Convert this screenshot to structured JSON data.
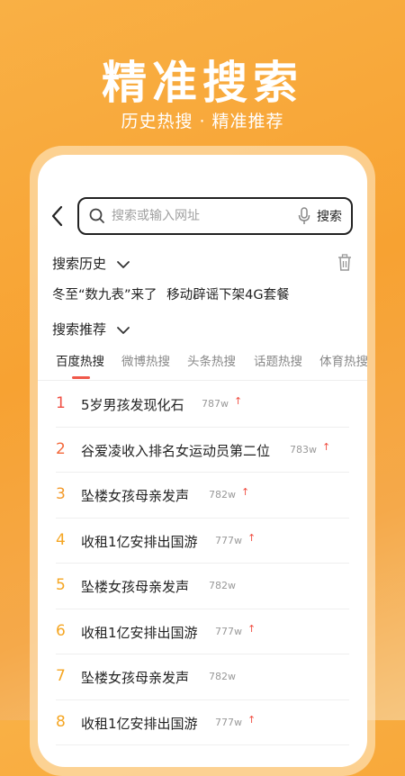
{
  "hero": {
    "title": "精准搜索",
    "subtitle": "历史热搜 · 精准推荐"
  },
  "search": {
    "placeholder": "搜索或输入网址",
    "button_label": "搜索"
  },
  "history": {
    "title": "搜索历史",
    "items": [
      "冬至“数九表”来了",
      "移动辟谣下架4G套餐"
    ]
  },
  "recommend": {
    "title": "搜索推荐"
  },
  "tabs": [
    {
      "label": "百度热搜",
      "active": true
    },
    {
      "label": "微博热搜",
      "active": false
    },
    {
      "label": "头条热搜",
      "active": false
    },
    {
      "label": "话题热搜",
      "active": false
    },
    {
      "label": "体育热搜",
      "active": false
    }
  ],
  "hot_list": [
    {
      "rank": "1",
      "title": "5岁男孩发现化石",
      "count": "787w",
      "trend": "up"
    },
    {
      "rank": "2",
      "title": "谷爱凌收入排名女运动员第二位",
      "count": "783w",
      "trend": "up"
    },
    {
      "rank": "3",
      "title": "坠楼女孩母亲发声",
      "count": "782w",
      "trend": "up"
    },
    {
      "rank": "4",
      "title": "收租1亿安排出国游",
      "count": "777w",
      "trend": "up"
    },
    {
      "rank": "5",
      "title": "坠楼女孩母亲发声",
      "count": "782w",
      "trend": ""
    },
    {
      "rank": "6",
      "title": "收租1亿安排出国游",
      "count": "777w",
      "trend": "up"
    },
    {
      "rank": "7",
      "title": "坠楼女孩母亲发声",
      "count": "782w",
      "trend": ""
    },
    {
      "rank": "8",
      "title": "收租1亿安排出国游",
      "count": "777w",
      "trend": "up"
    }
  ],
  "colors": {
    "rank_1": "#f04f43",
    "rank_2": "#f3683a",
    "rank_3": "#f39a2b",
    "rank_other": "#f5a623",
    "accent_underline": "#f0584a",
    "background_orange": "#f7a232"
  },
  "icons": [
    "back-arrow-icon",
    "search-icon",
    "mic-icon",
    "chevron-down-icon",
    "trash-icon",
    "trend-up-icon"
  ]
}
